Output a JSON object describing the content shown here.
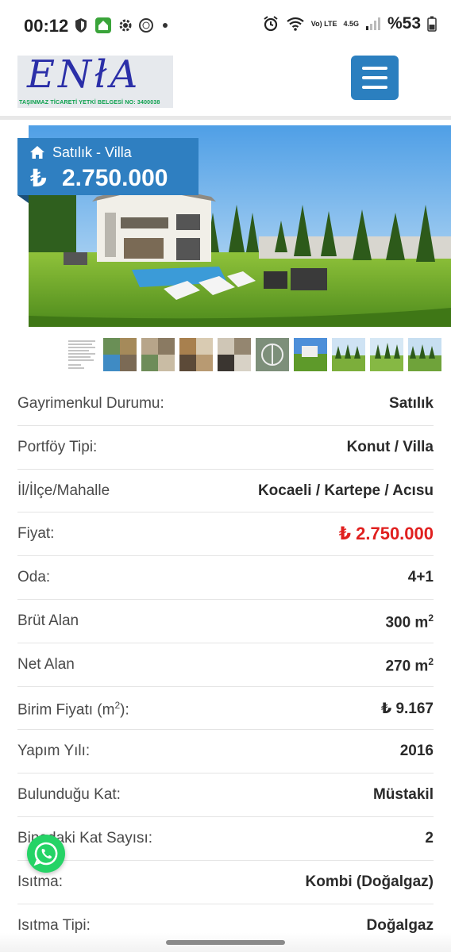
{
  "status_bar": {
    "time": "00:12",
    "network": "Vo) LTE",
    "signal_type": "4.5G",
    "battery": "%53"
  },
  "header": {
    "logo_text": "ENłA",
    "logo_subtitle": "TAŞINMAZ TİCARETİ YETKİ BELGESİ NO: 3400038"
  },
  "listing": {
    "type": "Satılık - Villa",
    "currency_symbol": "₺",
    "price": "2.750.000"
  },
  "details": [
    {
      "label": "Gayrimenkul Durumu:",
      "value": "Satılık"
    },
    {
      "label": "Portföy Tipi:",
      "value": "Konut / Villa"
    },
    {
      "label": "İl/İlçe/Mahalle",
      "value": "Kocaeli / Kartepe / Acısu"
    },
    {
      "label": "Fiyat:",
      "value": "₺ 2.750.000"
    },
    {
      "label": "Oda:",
      "value": "4+1"
    },
    {
      "label": "Brüt Alan",
      "value": "300 m",
      "sup": "2"
    },
    {
      "label": "Net Alan",
      "value": "270 m",
      "sup": "2"
    },
    {
      "label": "Birim Fiyatı (m",
      "label_sup": "2",
      "label_after": "):",
      "value": "₺ 9.167"
    },
    {
      "label": "Yapım Yılı:",
      "value": "2016"
    },
    {
      "label": "Bulunduğu Kat:",
      "value": "Müstakil"
    },
    {
      "label": "Binadaki Kat Sayısı:",
      "value": "2"
    },
    {
      "label": "Isıtma:",
      "value": "Kombi (Doğalgaz)"
    },
    {
      "label": "Isıtma Tipi:",
      "value": "Doğalgaz"
    }
  ],
  "colors": {
    "accent": "#2f7fc1",
    "price_red": "#e0201f",
    "whatsapp": "#25d366"
  }
}
